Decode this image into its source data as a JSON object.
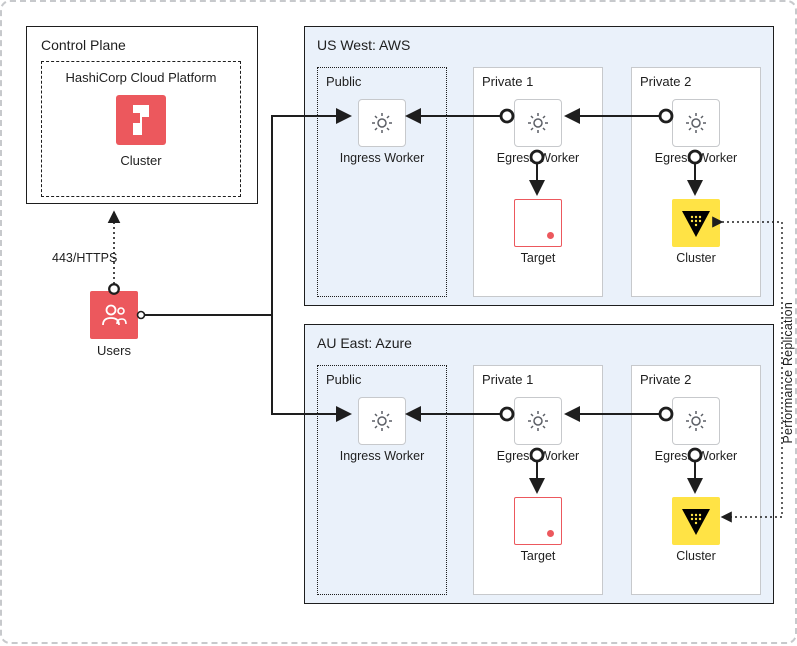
{
  "control_plane": {
    "title": "Control Plane",
    "hcp": {
      "title": "HashiCorp Cloud Platform",
      "cluster_label": "Cluster"
    }
  },
  "users": {
    "label": "Users",
    "connection_label": "443/HTTPS"
  },
  "regions": {
    "aws": {
      "title": "US West: AWS",
      "subnets": {
        "public": {
          "title": "Public",
          "worker_label": "Ingress Worker"
        },
        "priv1": {
          "title": "Private 1",
          "worker_label": "Egress Worker",
          "target_label": "Target"
        },
        "priv2": {
          "title": "Private 2",
          "worker_label": "Egress Worker",
          "cluster_label": "Cluster"
        }
      }
    },
    "azure": {
      "title": "AU East: Azure",
      "subnets": {
        "public": {
          "title": "Public",
          "worker_label": "Ingress Worker"
        },
        "priv1": {
          "title": "Private 1",
          "worker_label": "Egress Worker",
          "target_label": "Target"
        },
        "priv2": {
          "title": "Private 2",
          "worker_label": "Egress Worker",
          "cluster_label": "Cluster"
        }
      }
    }
  },
  "replication_label": "Performance Replication",
  "colors": {
    "accent_red": "#ec585d",
    "vault_yellow": "#ffe345",
    "region_bg": "#eaf1fa",
    "line": "#1e1e1e"
  }
}
